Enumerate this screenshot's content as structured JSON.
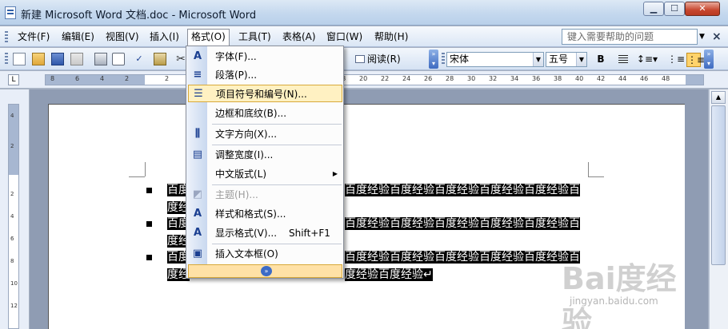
{
  "window": {
    "title": "新建 Microsoft Word 文档.doc - Microsoft Word",
    "min_glyph": "▁",
    "max_glyph": "☐",
    "close_glyph": "✕"
  },
  "menubar": {
    "items": [
      {
        "label": "文件(F)"
      },
      {
        "label": "编辑(E)"
      },
      {
        "label": "视图(V)"
      },
      {
        "label": "插入(I)"
      },
      {
        "label": "格式(O)"
      },
      {
        "label": "工具(T)"
      },
      {
        "label": "表格(A)"
      },
      {
        "label": "窗口(W)"
      },
      {
        "label": "帮助(H)"
      }
    ],
    "help_placeholder": "键入需要帮助的问题",
    "close_glyph": "×"
  },
  "toolbar": {
    "read_label": "阅读(R)",
    "font_name": "宋体",
    "font_size": "五号",
    "bold_label": "B"
  },
  "ruler": {
    "tab_glyph": "L",
    "numbers": [
      "8",
      "6",
      "4",
      "2",
      "2",
      "4",
      "6",
      "8",
      "10",
      "12",
      "14",
      "16",
      "18",
      "20",
      "22",
      "24",
      "26",
      "28",
      "30",
      "32",
      "34",
      "36",
      "38",
      "40",
      "42",
      "44",
      "46",
      "48"
    ],
    "vnumbers": [
      "4",
      "2",
      "2",
      "4",
      "6",
      "8",
      "10",
      "12"
    ]
  },
  "format_menu": {
    "items": [
      {
        "label": "字体(F)...",
        "icon": "font-icon",
        "glyph": "A"
      },
      {
        "label": "段落(P)...",
        "icon": "paragraph-icon",
        "glyph": "≡"
      },
      {
        "label": "项目符号和编号(N)...",
        "icon": "bullets-icon",
        "glyph": "☰",
        "highlighted": true
      },
      {
        "label": "边框和底纹(B)...",
        "icon": "",
        "glyph": ""
      },
      {
        "label": "文字方向(X)...",
        "icon": "text-direction-icon",
        "glyph": "⫼"
      },
      {
        "label": "调整宽度(I)...",
        "icon": "fit-width-icon",
        "glyph": "▤"
      },
      {
        "label": "中文版式(L)",
        "icon": "",
        "glyph": "",
        "submenu_glyph": "▶"
      },
      {
        "label": "主题(H)...",
        "icon": "theme-icon",
        "glyph": "◩",
        "disabled": true
      },
      {
        "label": "样式和格式(S)...",
        "icon": "styles-icon",
        "glyph": "A"
      },
      {
        "label": "显示格式(V)...",
        "icon": "reveal-format-icon",
        "glyph": "A",
        "shortcut": "Shift+F1"
      },
      {
        "label": "插入文本框(O)",
        "icon": "textbox-icon",
        "glyph": "▣"
      }
    ],
    "more_glyph": "»"
  },
  "document": {
    "lines": [
      {
        "prefix": "百度",
        "rest": "百度经验百度经验百度经验百度经验百度经验百"
      },
      {
        "prefix": "度经",
        "rest": ""
      },
      {
        "prefix": "百度",
        "rest": "百度经验百度经验百度经验百度经验百度经验百"
      },
      {
        "prefix": "度经",
        "rest": ""
      },
      {
        "prefix": "百度",
        "rest": "百度经验百度经验百度经验百度经验百度经验百"
      },
      {
        "prefix": "度经",
        "rest": "度经验百度经验↵"
      }
    ]
  },
  "watermark": {
    "logo": "Bai度经验",
    "url": "jingyan.baidu.com"
  }
}
